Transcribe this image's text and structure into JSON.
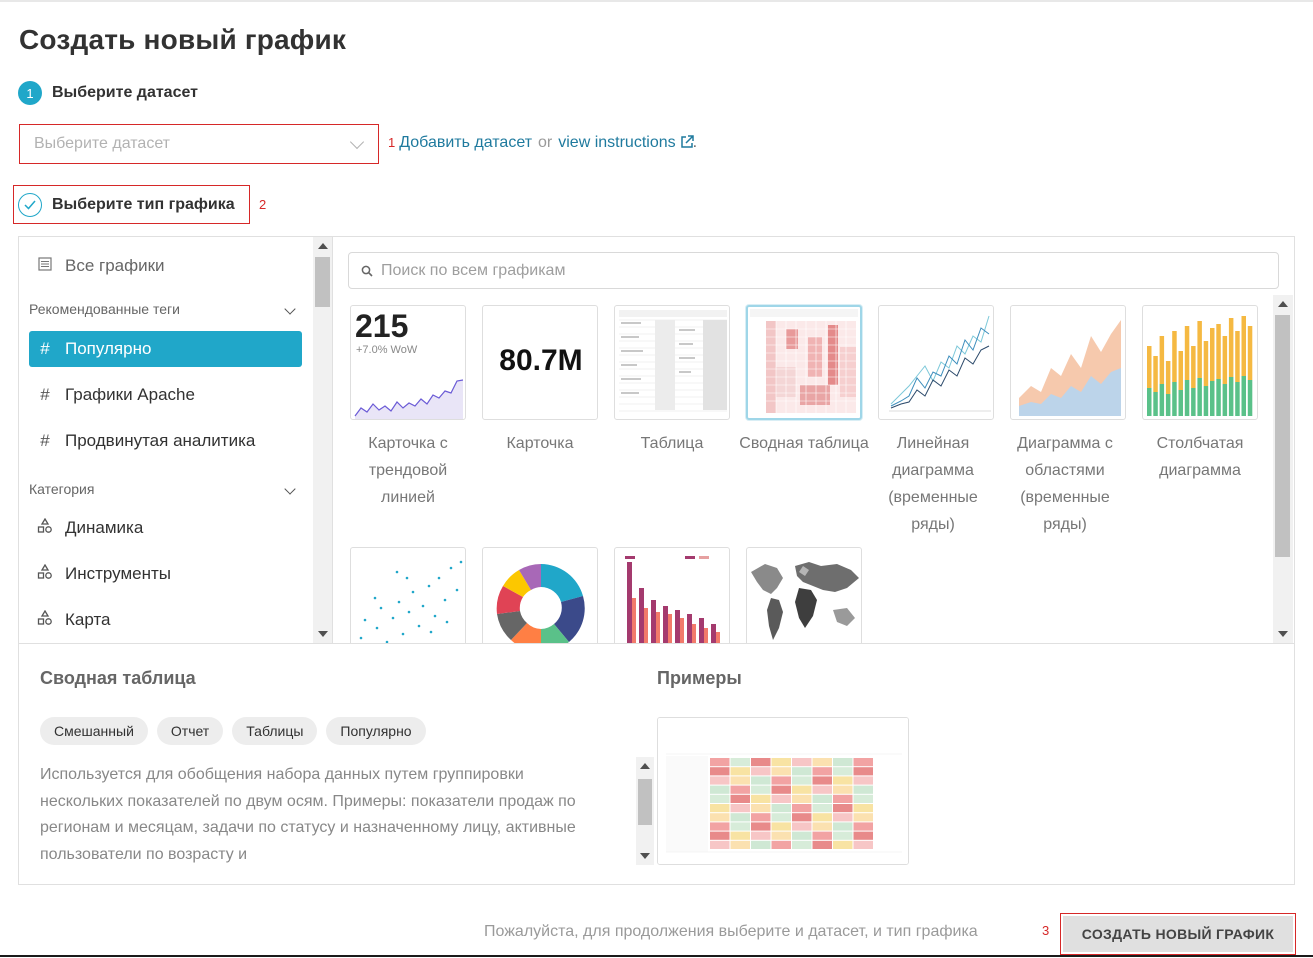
{
  "page": {
    "title": "Создать новый график"
  },
  "step1": {
    "number": "1",
    "label": "Выберите датасет",
    "dataset_placeholder": "Выберите датасет",
    "annotation": "1",
    "add_dataset_link": "Добавить датасет",
    "or_text": "or",
    "instructions_link": "view instructions",
    "period": "."
  },
  "step2": {
    "label": "Выберите тип графика",
    "annotation": "2"
  },
  "sidebar": {
    "all_charts": "Все графики",
    "recommended_header": "Рекомендованные теги",
    "tags": [
      {
        "label": "Популярно",
        "active": true
      },
      {
        "label": "Графики Apache",
        "active": false
      },
      {
        "label": "Продвинутая аналитика",
        "active": false
      }
    ],
    "category_header": "Категория",
    "categories": [
      {
        "label": "Динамика"
      },
      {
        "label": "Инструменты"
      },
      {
        "label": "Карта"
      }
    ]
  },
  "search": {
    "placeholder": "Поиск по всем графикам"
  },
  "charts": [
    {
      "label": "Карточка с трендовой линией",
      "big_number": "215",
      "sub": "+7.0% WoW",
      "icon": "big-number-trendline-thumb"
    },
    {
      "label": "Карточка",
      "big_number": "80.7M",
      "icon": "big-number-thumb"
    },
    {
      "label": "Таблица",
      "icon": "table-thumb"
    },
    {
      "label": "Сводная таблица",
      "icon": "pivot-table-thumb",
      "selected": true
    },
    {
      "label": "Линейная диаграмма (временные ряды)",
      "icon": "line-chart-thumb"
    },
    {
      "label": "Диаграмма с областями (временные ряды)",
      "icon": "area-chart-thumb"
    },
    {
      "label": "Столбчатая диаграмма",
      "icon": "bar-chart-thumb"
    },
    {
      "label": "",
      "icon": "scatter-thumb"
    },
    {
      "label": "",
      "icon": "donut-thumb"
    },
    {
      "label": "",
      "icon": "mixed-bar-thumb"
    },
    {
      "label": "",
      "icon": "world-map-thumb"
    }
  ],
  "details": {
    "title": "Сводная таблица",
    "tags": [
      "Смешанный",
      "Отчет",
      "Таблицы",
      "Популярно"
    ],
    "description": "Используется для обобщения набора данных путем группировки нескольких показателей по двум осям. Примеры: показатели продаж по регионам и месяцам, задачи по статусу и назначенному лицу, активные пользователи по возрасту и",
    "examples_title": "Примеры"
  },
  "footer": {
    "hint": "Пожалуйста, для продолжения выберите и датасет, и тип графика",
    "annotation": "3",
    "create_button": "СОЗДАТЬ НОВЫЙ ГРАФИК"
  },
  "colors": {
    "accent": "#20a7c9",
    "annotation_red": "#d62828",
    "link": "#1f7a9e"
  }
}
